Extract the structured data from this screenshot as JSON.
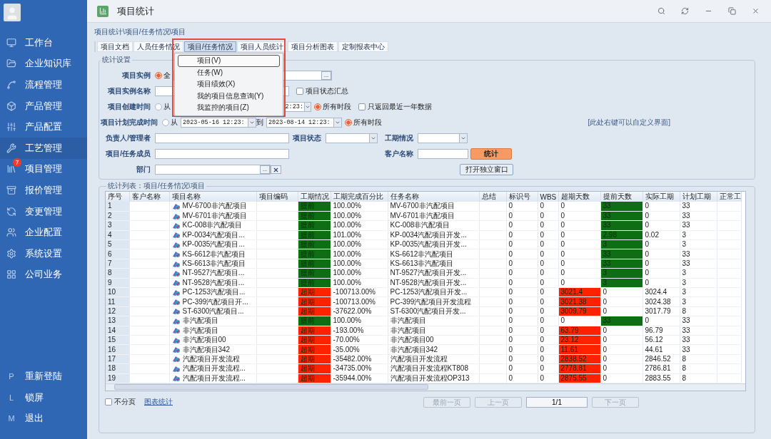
{
  "sidebar": {
    "items": [
      {
        "label": "工作台",
        "selected": false
      },
      {
        "label": "企业知识库",
        "selected": false
      },
      {
        "label": "流程管理",
        "selected": false
      },
      {
        "label": "产品管理",
        "selected": false
      },
      {
        "label": "产品配置",
        "selected": false
      },
      {
        "label": "工艺管理",
        "selected": true
      },
      {
        "label": "项目管理",
        "selected": false,
        "badge": "7"
      },
      {
        "label": "报价管理",
        "selected": false
      },
      {
        "label": "变更管理",
        "selected": false
      },
      {
        "label": "企业配置",
        "selected": false
      },
      {
        "label": "系统设置",
        "selected": false
      },
      {
        "label": "公司业务",
        "selected": false
      }
    ],
    "bottom_items": [
      {
        "key": "P",
        "label": "重新登陆"
      },
      {
        "key": "L",
        "label": "锁屏"
      },
      {
        "key": "M",
        "label": "退出"
      }
    ]
  },
  "window": {
    "title": "项目统计"
  },
  "breadcrumb": "项目统计\\项目/任务情况\\项目",
  "tabs": [
    {
      "label": "项目文档",
      "selected": false
    },
    {
      "label": "人员任务情况",
      "selected": false
    },
    {
      "label": "项目/任务情况",
      "selected": true
    },
    {
      "label": "项目人员统计",
      "selected": false
    },
    {
      "label": "项目分析图表",
      "selected": false
    },
    {
      "label": "定制报表中心",
      "selected": false
    }
  ],
  "menu": {
    "items": [
      {
        "label": "项目(V)",
        "selected": true
      },
      {
        "label": "任务(W)",
        "selected": false
      },
      {
        "label": "项目绩效(X)",
        "selected": false
      },
      {
        "label": "我的项目信息查询(Y)",
        "selected": false
      },
      {
        "label": "我监控的项目(Z)",
        "selected": false
      }
    ]
  },
  "settings": {
    "title": "统计设置",
    "hint": "[此处右键可以自定义界面]",
    "instance": {
      "label": "项目实例",
      "radio": {
        "label": "全",
        "selected": true
      },
      "browse_button": "..."
    },
    "instance_name": {
      "label": "项目实例名称",
      "checkbox": {
        "label": "项目状态汇总",
        "checked": false
      }
    },
    "created": {
      "label": "项目创建时间",
      "from": {
        "label": "从",
        "selected": false
      },
      "end": "2:23:",
      "all": {
        "label": "所有时段",
        "selected": true
      },
      "checkbox": {
        "label": "只返回最近一年数据",
        "checked": false
      }
    },
    "planned_finish": {
      "label": "项目计划完成时间",
      "from": {
        "label": "从",
        "selected": false
      },
      "start": "2023-05-16 12:23:",
      "to_label": "到",
      "end": "2023-08-14 12:23:",
      "all": {
        "label": "所有时段",
        "selected": true
      }
    },
    "owner": {
      "label": "负责人/管理者"
    },
    "status": {
      "label": "项目状态"
    },
    "schedule": {
      "label": "工期情况"
    },
    "member": {
      "label": "项目/任务成员"
    },
    "customer": {
      "label": "客户名称"
    },
    "stat_button": "统计",
    "department": {
      "label": "部门",
      "browse_button": "..."
    },
    "open_window_button": "打开独立窗口"
  },
  "table": {
    "title": "统计列表：项目/任务情况\\项目",
    "columns": [
      "序号",
      "客户名称",
      "项目名称",
      "项目编码",
      "工期情况",
      "工期完成百分比",
      "任务名称",
      "总结",
      "标识号",
      "WBS",
      "超期天数",
      "提前天数",
      "实际工期",
      "计划工期",
      "正常工"
    ],
    "rows": [
      {
        "seq": "1",
        "project": "MV-6700非汽配项目",
        "status": {
          "kind": "ahead",
          "label": "提前"
        },
        "pct": "100.00%",
        "task": "MV-6700非汽配项目",
        "id": "0",
        "wbs": "0",
        "overdue_days": "0",
        "ahead_days": "33",
        "actual": "0",
        "planned": "33"
      },
      {
        "seq": "2",
        "project": "MV-6701非汽配项目",
        "status": {
          "kind": "ahead",
          "label": "提前"
        },
        "pct": "100.00%",
        "task": "MV-6701非汽配项目",
        "id": "0",
        "wbs": "0",
        "overdue_days": "0",
        "ahead_days": "33",
        "actual": "0",
        "planned": "33"
      },
      {
        "seq": "3",
        "project": "KC-008非汽配项目",
        "status": {
          "kind": "ahead",
          "label": "提前"
        },
        "pct": "100.00%",
        "task": "KC-008非汽配项目",
        "id": "0",
        "wbs": "0",
        "overdue_days": "0",
        "ahead_days": "33",
        "actual": "0",
        "planned": "33"
      },
      {
        "seq": "4",
        "project": "KP-0034汽配项目...",
        "status": {
          "kind": "ahead",
          "label": "提前"
        },
        "pct": "101.00%",
        "task": "KP-0034汽配项目开发...",
        "id": "0",
        "wbs": "0",
        "overdue_days": "0",
        "ahead_days": "2.98",
        "actual": "0.02",
        "planned": "3"
      },
      {
        "seq": "5",
        "project": "KP-0035汽配项目...",
        "status": {
          "kind": "ahead",
          "label": "提前"
        },
        "pct": "100.00%",
        "task": "KP-0035汽配项目开发...",
        "id": "0",
        "wbs": "0",
        "overdue_days": "0",
        "ahead_days": "3",
        "actual": "0",
        "planned": "3"
      },
      {
        "seq": "6",
        "project": "KS-6612非汽配项目",
        "status": {
          "kind": "ahead",
          "label": "提前"
        },
        "pct": "100.00%",
        "task": "KS-6612非汽配项目",
        "id": "0",
        "wbs": "0",
        "overdue_days": "0",
        "ahead_days": "33",
        "actual": "0",
        "planned": "33"
      },
      {
        "seq": "7",
        "project": "KS-6613非汽配项目",
        "status": {
          "kind": "ahead",
          "label": "提前"
        },
        "pct": "100.00%",
        "task": "KS-6613非汽配项目",
        "id": "0",
        "wbs": "0",
        "overdue_days": "0",
        "ahead_days": "33",
        "actual": "0",
        "planned": "33"
      },
      {
        "seq": "8",
        "project": "NT-9527汽配项目...",
        "status": {
          "kind": "ahead",
          "label": "提前"
        },
        "pct": "100.00%",
        "task": "NT-9527汽配项目开发...",
        "id": "0",
        "wbs": "0",
        "overdue_days": "0",
        "ahead_days": "3",
        "actual": "0",
        "planned": "3"
      },
      {
        "seq": "9",
        "project": "NT-9528汽配项目...",
        "status": {
          "kind": "ahead",
          "label": "提前"
        },
        "pct": "100.00%",
        "task": "NT-9528汽配项目开发...",
        "id": "0",
        "wbs": "0",
        "overdue_days": "0",
        "ahead_days": "3",
        "actual": "0",
        "planned": "3"
      },
      {
        "seq": "10",
        "project": "PC-1253汽配项目...",
        "status": {
          "kind": "overdue",
          "label": "超期"
        },
        "pct": "-100713.00%",
        "task": "PC-1253汽配项目开发...",
        "id": "0",
        "wbs": "0",
        "overdue_days": "3021.4",
        "ahead_days": "0",
        "actual": "3024.4",
        "planned": "3"
      },
      {
        "seq": "11",
        "project": "PC-399汽配项目开...",
        "status": {
          "kind": "overdue",
          "label": "超期"
        },
        "pct": "-100713.00%",
        "task": "PC-399汽配项目开发流程",
        "id": "0",
        "wbs": "0",
        "overdue_days": "3021.38",
        "ahead_days": "0",
        "actual": "3024.38",
        "planned": "3"
      },
      {
        "seq": "12",
        "project": "ST-6300汽配项目...",
        "status": {
          "kind": "overdue",
          "label": "超期"
        },
        "pct": "-37622.00%",
        "task": "ST-6300汽配项目开发...",
        "id": "0",
        "wbs": "0",
        "overdue_days": "3009.79",
        "ahead_days": "0",
        "actual": "3017.79",
        "planned": "8"
      },
      {
        "seq": "13",
        "project": "非汽配项目",
        "status": {
          "kind": "ahead",
          "label": "提前"
        },
        "pct": "100.00%",
        "task": "非汽配项目",
        "id": "0",
        "wbs": "0",
        "overdue_days": "0",
        "ahead_days": "33",
        "actual": "0",
        "planned": "33"
      },
      {
        "seq": "14",
        "project": "非汽配项目",
        "status": {
          "kind": "overdue",
          "label": "超期"
        },
        "pct": "-193.00%",
        "task": "非汽配项目",
        "id": "0",
        "wbs": "0",
        "overdue_days": "63.79",
        "ahead_days": "0",
        "actual": "96.79",
        "planned": "33"
      },
      {
        "seq": "15",
        "project": "非汽配项目00",
        "status": {
          "kind": "overdue",
          "label": "超期"
        },
        "pct": "-70.00%",
        "task": "非汽配项目00",
        "id": "0",
        "wbs": "0",
        "overdue_days": "23.12",
        "ahead_days": "0",
        "actual": "56.12",
        "planned": "33"
      },
      {
        "seq": "16",
        "project": "非汽配项目342",
        "status": {
          "kind": "overdue",
          "label": "超期"
        },
        "pct": "-35.00%",
        "task": "非汽配项目342",
        "id": "0",
        "wbs": "0",
        "overdue_days": "11.61",
        "ahead_days": "0",
        "actual": "44.61",
        "planned": "33"
      },
      {
        "seq": "17",
        "project": "汽配项目开发流程",
        "status": {
          "kind": "overdue",
          "label": "超期"
        },
        "pct": "-35482.00%",
        "task": "汽配项目开发流程",
        "id": "0",
        "wbs": "0",
        "overdue_days": "2838.52",
        "ahead_days": "0",
        "actual": "2846.52",
        "planned": "8"
      },
      {
        "seq": "18",
        "project": "汽配项目开发流程...",
        "status": {
          "kind": "overdue",
          "label": "超期"
        },
        "pct": "-34735.00%",
        "task": "汽配项目开发流程KT808",
        "id": "0",
        "wbs": "0",
        "overdue_days": "2778.81",
        "ahead_days": "0",
        "actual": "2786.81",
        "planned": "8"
      },
      {
        "seq": "19",
        "project": "汽配项目开发流程...",
        "status": {
          "kind": "overdue",
          "label": "超期"
        },
        "pct": "-35944.00%",
        "task": "汽配项目开发流程OP313",
        "id": "0",
        "wbs": "0",
        "overdue_days": "2875.55",
        "ahead_days": "0",
        "actual": "2883.55",
        "planned": "8"
      }
    ]
  },
  "footer": {
    "checkbox": {
      "label": "不分页",
      "checked": false
    },
    "link": "图表统计",
    "pager": [
      {
        "label": "最前一页",
        "disabled": true
      },
      {
        "label": "上一页",
        "disabled": true
      },
      {
        "label": "1/1",
        "kind": "page"
      },
      {
        "label": "下一页",
        "disabled": true
      }
    ]
  }
}
